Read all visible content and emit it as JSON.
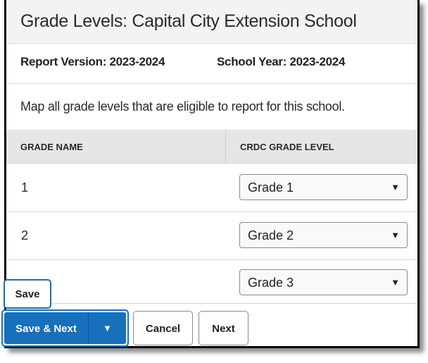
{
  "header": {
    "title": "Grade Levels: Capital City Extension School"
  },
  "meta": {
    "report_version": "Report Version: 2023-2024",
    "school_year": "School Year: 2023-2024"
  },
  "description": "Map all grade levels that are eligible to report for this school.",
  "table": {
    "columns": [
      "GRADE NAME",
      "CRDC GRADE LEVEL"
    ],
    "rows": [
      {
        "grade_name": "1",
        "crdc_grade_level": "Grade 1"
      },
      {
        "grade_name": "2",
        "crdc_grade_level": "Grade 2"
      },
      {
        "grade_name": "",
        "crdc_grade_level": "Grade 3"
      }
    ]
  },
  "icons": {
    "dropdown": "▼"
  },
  "actions": {
    "save": "Save",
    "save_next": "Save & Next",
    "cancel": "Cancel",
    "next": "Next"
  },
  "colors": {
    "primary": "#1670bb",
    "focus": "#1a6fb8"
  }
}
